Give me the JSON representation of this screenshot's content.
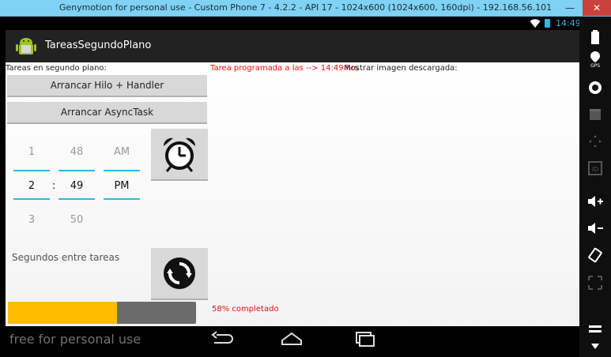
{
  "window": {
    "title": "Genymotion for personal use - Custom Phone 7 - 4.2.2 - API 17 - 1024x600 (1024x600, 160dpi) - 192.168.56.101"
  },
  "statusbar": {
    "time": "14:49"
  },
  "app": {
    "title": "TareasSegundoPlano"
  },
  "left": {
    "section_label": "Tareas en segundo plano:",
    "btn_thread_handler": "Arrancar Hilo + Handler",
    "btn_asynctask": "Arrancar AsyncTask",
    "time_picker": {
      "hour_prev": "1",
      "hour": "2",
      "hour_next": "3",
      "minute_prev": "48",
      "minute": "49",
      "minute_next": "50",
      "ampm_prev": "AM",
      "ampm": "PM",
      "separator": ":"
    },
    "seconds_label": "Segundos entre tareas",
    "progress_percent": 58,
    "progress_text": "58% completado"
  },
  "right": {
    "scheduled_text": "Tarea programada a las --> 14:49 hrs",
    "show_image_label": "Mostrar imagen descargada:"
  },
  "navbar": {
    "watermark": "free for personal use"
  },
  "colors": {
    "accent": "#33b5e5",
    "progress_fill": "#ffbb00",
    "alert_red": "#e01010"
  }
}
